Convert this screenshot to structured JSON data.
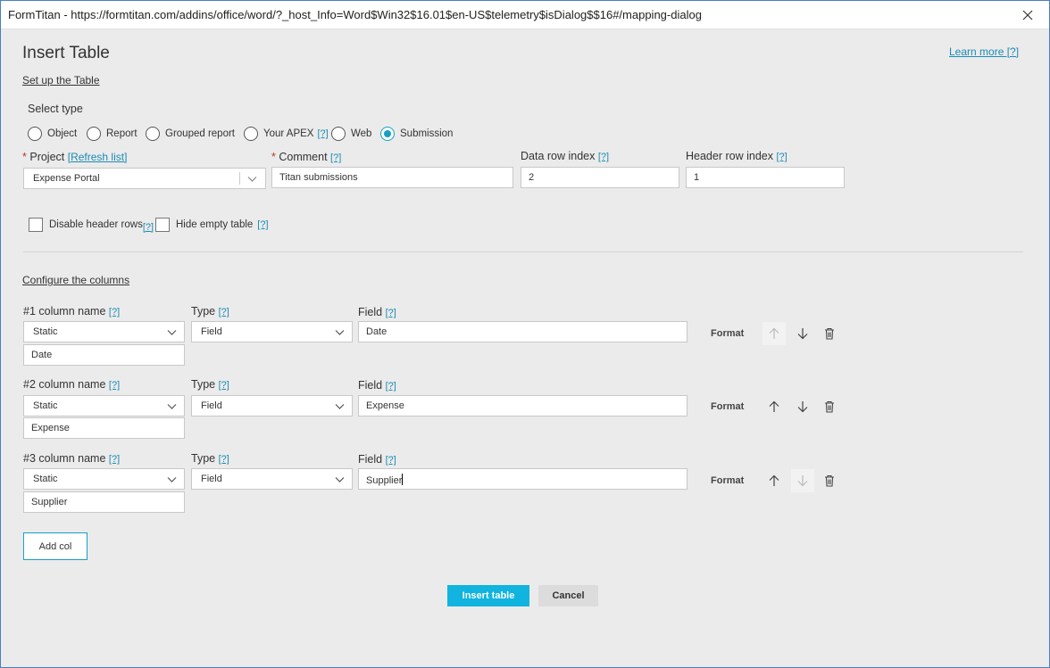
{
  "window": {
    "title": "FormTitan - https://formtitan.com/addins/office/word/?_host_Info=Word$Win32$16.01$en-US$telemetry$isDialog$$16#/mapping-dialog"
  },
  "header": {
    "title": "Insert Table",
    "learn_more": "Learn more [?]"
  },
  "setup": {
    "section_link": "Set up the Table",
    "select_type_label": "Select type",
    "types": [
      {
        "label": "Object",
        "selected": false
      },
      {
        "label": "Report",
        "selected": false
      },
      {
        "label": "Grouped report",
        "selected": false
      },
      {
        "label": "Your APEX",
        "selected": false,
        "help": "[?]"
      },
      {
        "label": "Web",
        "selected": false
      },
      {
        "label": "Submission",
        "selected": true
      }
    ],
    "project": {
      "required_mark": "*",
      "label": "Project",
      "refresh": "[Refresh list]",
      "value": "Expense Portal"
    },
    "comment": {
      "required_mark": "*",
      "label": "Comment",
      "help": "[?]",
      "value": "Titan submissions"
    },
    "data_row_index": {
      "label": "Data row index",
      "help": "[?]",
      "value": "2"
    },
    "header_row_index": {
      "label": "Header row index",
      "help": "[?]",
      "value": "1"
    },
    "disable_header_rows": {
      "label": "Disable header rows",
      "help": "[?]",
      "checked": false
    },
    "hide_empty_table": {
      "label": "Hide empty table",
      "help": "[?]",
      "checked": false
    }
  },
  "columns": {
    "section_link": "Configure the columns",
    "type_label": "Type",
    "field_label": "Field",
    "help": "[?]",
    "format_label": "Format",
    "items": [
      {
        "name_label": "#1 column name",
        "name_mode": "Static",
        "name_value": "Date",
        "type": "Field",
        "field": "Date",
        "up_disabled": true,
        "down_disabled": false
      },
      {
        "name_label": "#2 column name",
        "name_mode": "Static",
        "name_value": "Expense",
        "type": "Field",
        "field": "Expense",
        "up_disabled": false,
        "down_disabled": false
      },
      {
        "name_label": "#3 column name",
        "name_mode": "Static",
        "name_value": "Supplier",
        "type": "Field",
        "field": "Supplier",
        "up_disabled": false,
        "down_disabled": true
      }
    ],
    "add_col": "Add col"
  },
  "footer": {
    "insert_table": "Insert table",
    "cancel": "Cancel"
  },
  "colors": {
    "accent": "#10b4de",
    "link": "#1a8bb5",
    "required": "#c0392b",
    "background": "#ebebeb"
  }
}
